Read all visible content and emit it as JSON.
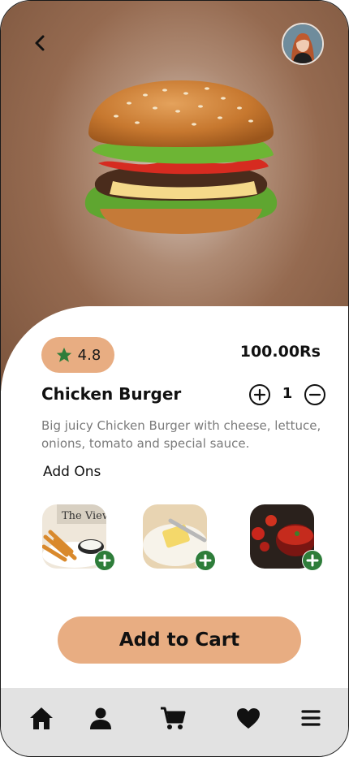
{
  "product": {
    "name": "Chicken Burger",
    "rating": "4.8",
    "price": "100.00Rs",
    "quantity": "1",
    "description": "Big juicy Chicken Burger with cheese, lettuce, onions, tomato and special sauce."
  },
  "addons": {
    "label": "Add Ons",
    "items": [
      {
        "image": "fries-with-dip"
      },
      {
        "image": "butter-block"
      },
      {
        "image": "tomato-sauce"
      }
    ]
  },
  "cart": {
    "label": "Add to Cart"
  },
  "nav": {
    "items": [
      {
        "icon": "home-icon"
      },
      {
        "icon": "user-icon"
      },
      {
        "icon": "cart-icon"
      },
      {
        "icon": "heart-icon"
      },
      {
        "icon": "menu-icon"
      }
    ]
  },
  "colors": {
    "accent": "#e8ad82",
    "addon_plus": "#2e7d3a",
    "star": "#2e7d3a",
    "navbar": "#e2e2e2"
  }
}
